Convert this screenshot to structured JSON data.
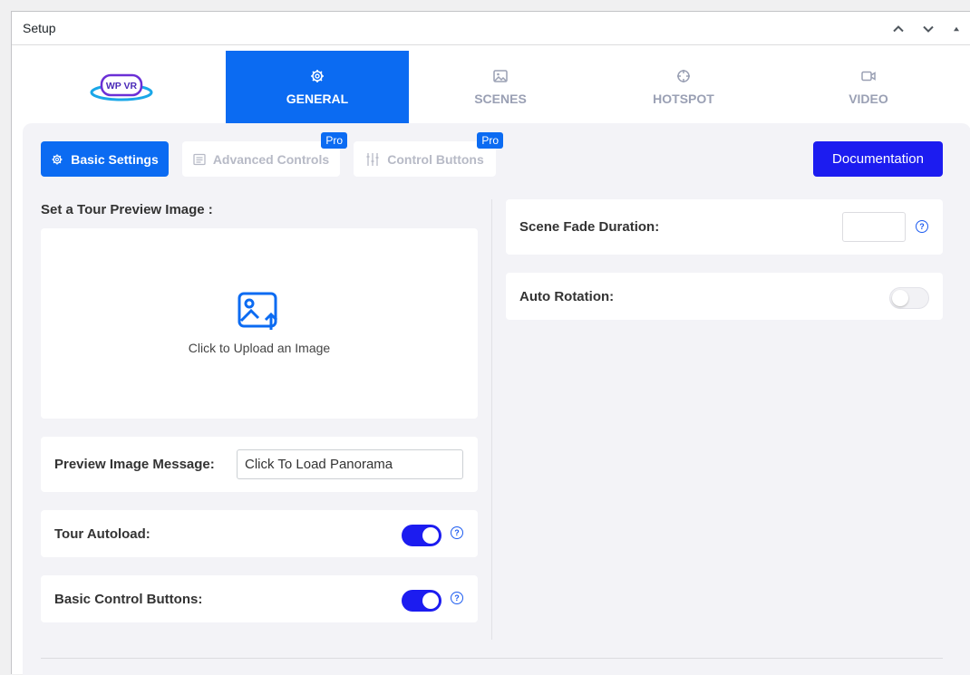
{
  "panel": {
    "title": "Setup"
  },
  "logo": {
    "text": "WP VR"
  },
  "tabs": [
    {
      "label": "GENERAL",
      "icon": "gear-icon",
      "active": true
    },
    {
      "label": "SCENES",
      "icon": "image-icon",
      "active": false
    },
    {
      "label": "HOTSPOT",
      "icon": "crosshair-icon",
      "active": false
    },
    {
      "label": "VIDEO",
      "icon": "video-camera-icon",
      "active": false
    }
  ],
  "subtabs": {
    "basic": "Basic Settings",
    "advanced": "Advanced Controls",
    "control": "Control Buttons",
    "pro_badge": "Pro"
  },
  "documentation": "Documentation",
  "preview": {
    "label": "Set a Tour Preview Image :",
    "upload_text": "Click to Upload an Image"
  },
  "preview_message": {
    "label": "Preview Image Message:",
    "value": "Click To Load Panorama"
  },
  "tour_autoload": {
    "label": "Tour Autoload:",
    "enabled": true
  },
  "basic_control_buttons": {
    "label": "Basic Control Buttons:",
    "enabled": true
  },
  "scene_fade": {
    "label": "Scene Fade Duration:",
    "value": ""
  },
  "auto_rotation": {
    "label": "Auto Rotation:",
    "enabled": false
  },
  "help_glyph": "?",
  "colors": {
    "accent": "#0b6bf2",
    "primary": "#1c1cf0",
    "muted": "#9aa0b4"
  }
}
